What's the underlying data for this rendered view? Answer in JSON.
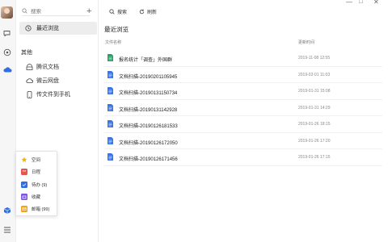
{
  "sidebar": {
    "search_placeholder": "搜索",
    "recent_label": "最近浏览",
    "section_title": "其他",
    "items": [
      {
        "label": "腾讯文档",
        "icon": "tencent-docs-icon"
      },
      {
        "label": "微云网盘",
        "icon": "weiyun-cloud-icon"
      },
      {
        "label": "传文件到手机",
        "icon": "phone-icon"
      }
    ]
  },
  "popup": {
    "items": [
      {
        "label": "空间",
        "icon": "star-icon",
        "color": "#f5b700"
      },
      {
        "label": "日程",
        "icon": "calendar-icon",
        "color": "#e8554e"
      },
      {
        "label": "待办 (9)",
        "icon": "todo-check-icon",
        "color": "#2f6fe0"
      },
      {
        "label": "收藏",
        "icon": "box-icon",
        "color": "#7b55e0"
      },
      {
        "label": "邮箱 (99)",
        "icon": "mail-icon",
        "color": "#f0a21b"
      }
    ]
  },
  "toolbar": {
    "search_label": "搜索",
    "refresh_label": "刷新"
  },
  "main": {
    "title": "最近浏览",
    "col_name": "文件名称",
    "col_time": "更新时间",
    "files": [
      {
        "name": "报名统计「调查」外国群",
        "time": "2019-11-08 12:55",
        "type": "sheet"
      },
      {
        "name": "文档扫描-20190201105945",
        "time": "2019-02-01 11:03",
        "type": "doc"
      },
      {
        "name": "文档扫描-20190131150734",
        "time": "2019-01-31 15:08",
        "type": "doc"
      },
      {
        "name": "文档扫描-20190131142928",
        "time": "2019-01-31 14:29",
        "type": "doc"
      },
      {
        "name": "文档扫描-20190126181533",
        "time": "2019-01-26 18:15",
        "type": "doc"
      },
      {
        "name": "文档扫描-20190126172050",
        "time": "2019-01-26 17:20",
        "type": "doc"
      },
      {
        "name": "文档扫描-20190126171456",
        "time": "2019-01-26 17:15",
        "type": "doc"
      }
    ]
  },
  "colors": {
    "doc_blue": "#3b76e8",
    "sheet_green": "#21a466",
    "active_bg": "#ededee"
  }
}
